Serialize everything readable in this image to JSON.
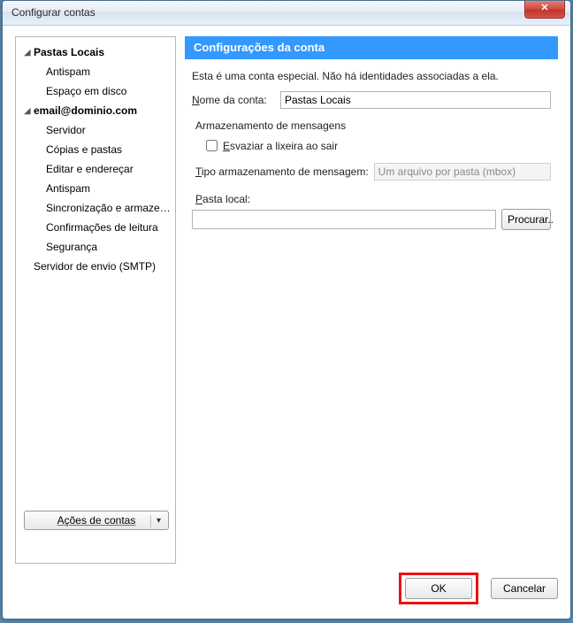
{
  "window": {
    "title": "Configurar contas",
    "close_glyph": "✕"
  },
  "sidebar": {
    "groups": [
      {
        "label": "Pastas Locais",
        "expandable": true
      },
      {
        "label": "Antispam"
      },
      {
        "label": "Espaço em disco"
      },
      {
        "label": "email@dominio.com",
        "expandable": true
      },
      {
        "label": "Servidor"
      },
      {
        "label": "Cópias e pastas"
      },
      {
        "label": "Editar e endereçar"
      },
      {
        "label": "Antispam"
      },
      {
        "label": "Sincronização e armazena..."
      },
      {
        "label": "Confirmações de leitura"
      },
      {
        "label": "Segurança"
      },
      {
        "label": "Servidor de envio (SMTP)",
        "top": true
      }
    ],
    "actions_label": "Ações de contas",
    "actions_caret": "▾"
  },
  "panel": {
    "header": "Configurações da conta",
    "description": "Esta é uma conta especial. Não há identidades associadas a ela.",
    "account_name_label": "Nome da conta:",
    "account_name_value": "Pastas Locais",
    "storage_group": "Armazenamento de mensagens",
    "empty_trash_label": "Esvaziar a lixeira ao sair",
    "storage_type_label": "Tipo armazenamento de mensagem:",
    "storage_type_value": "Um arquivo por pasta (mbox)",
    "local_folder_label": "Pasta local:",
    "local_folder_value": "",
    "browse_label": "Procurar.."
  },
  "footer": {
    "ok": "OK",
    "cancel": "Cancelar"
  }
}
